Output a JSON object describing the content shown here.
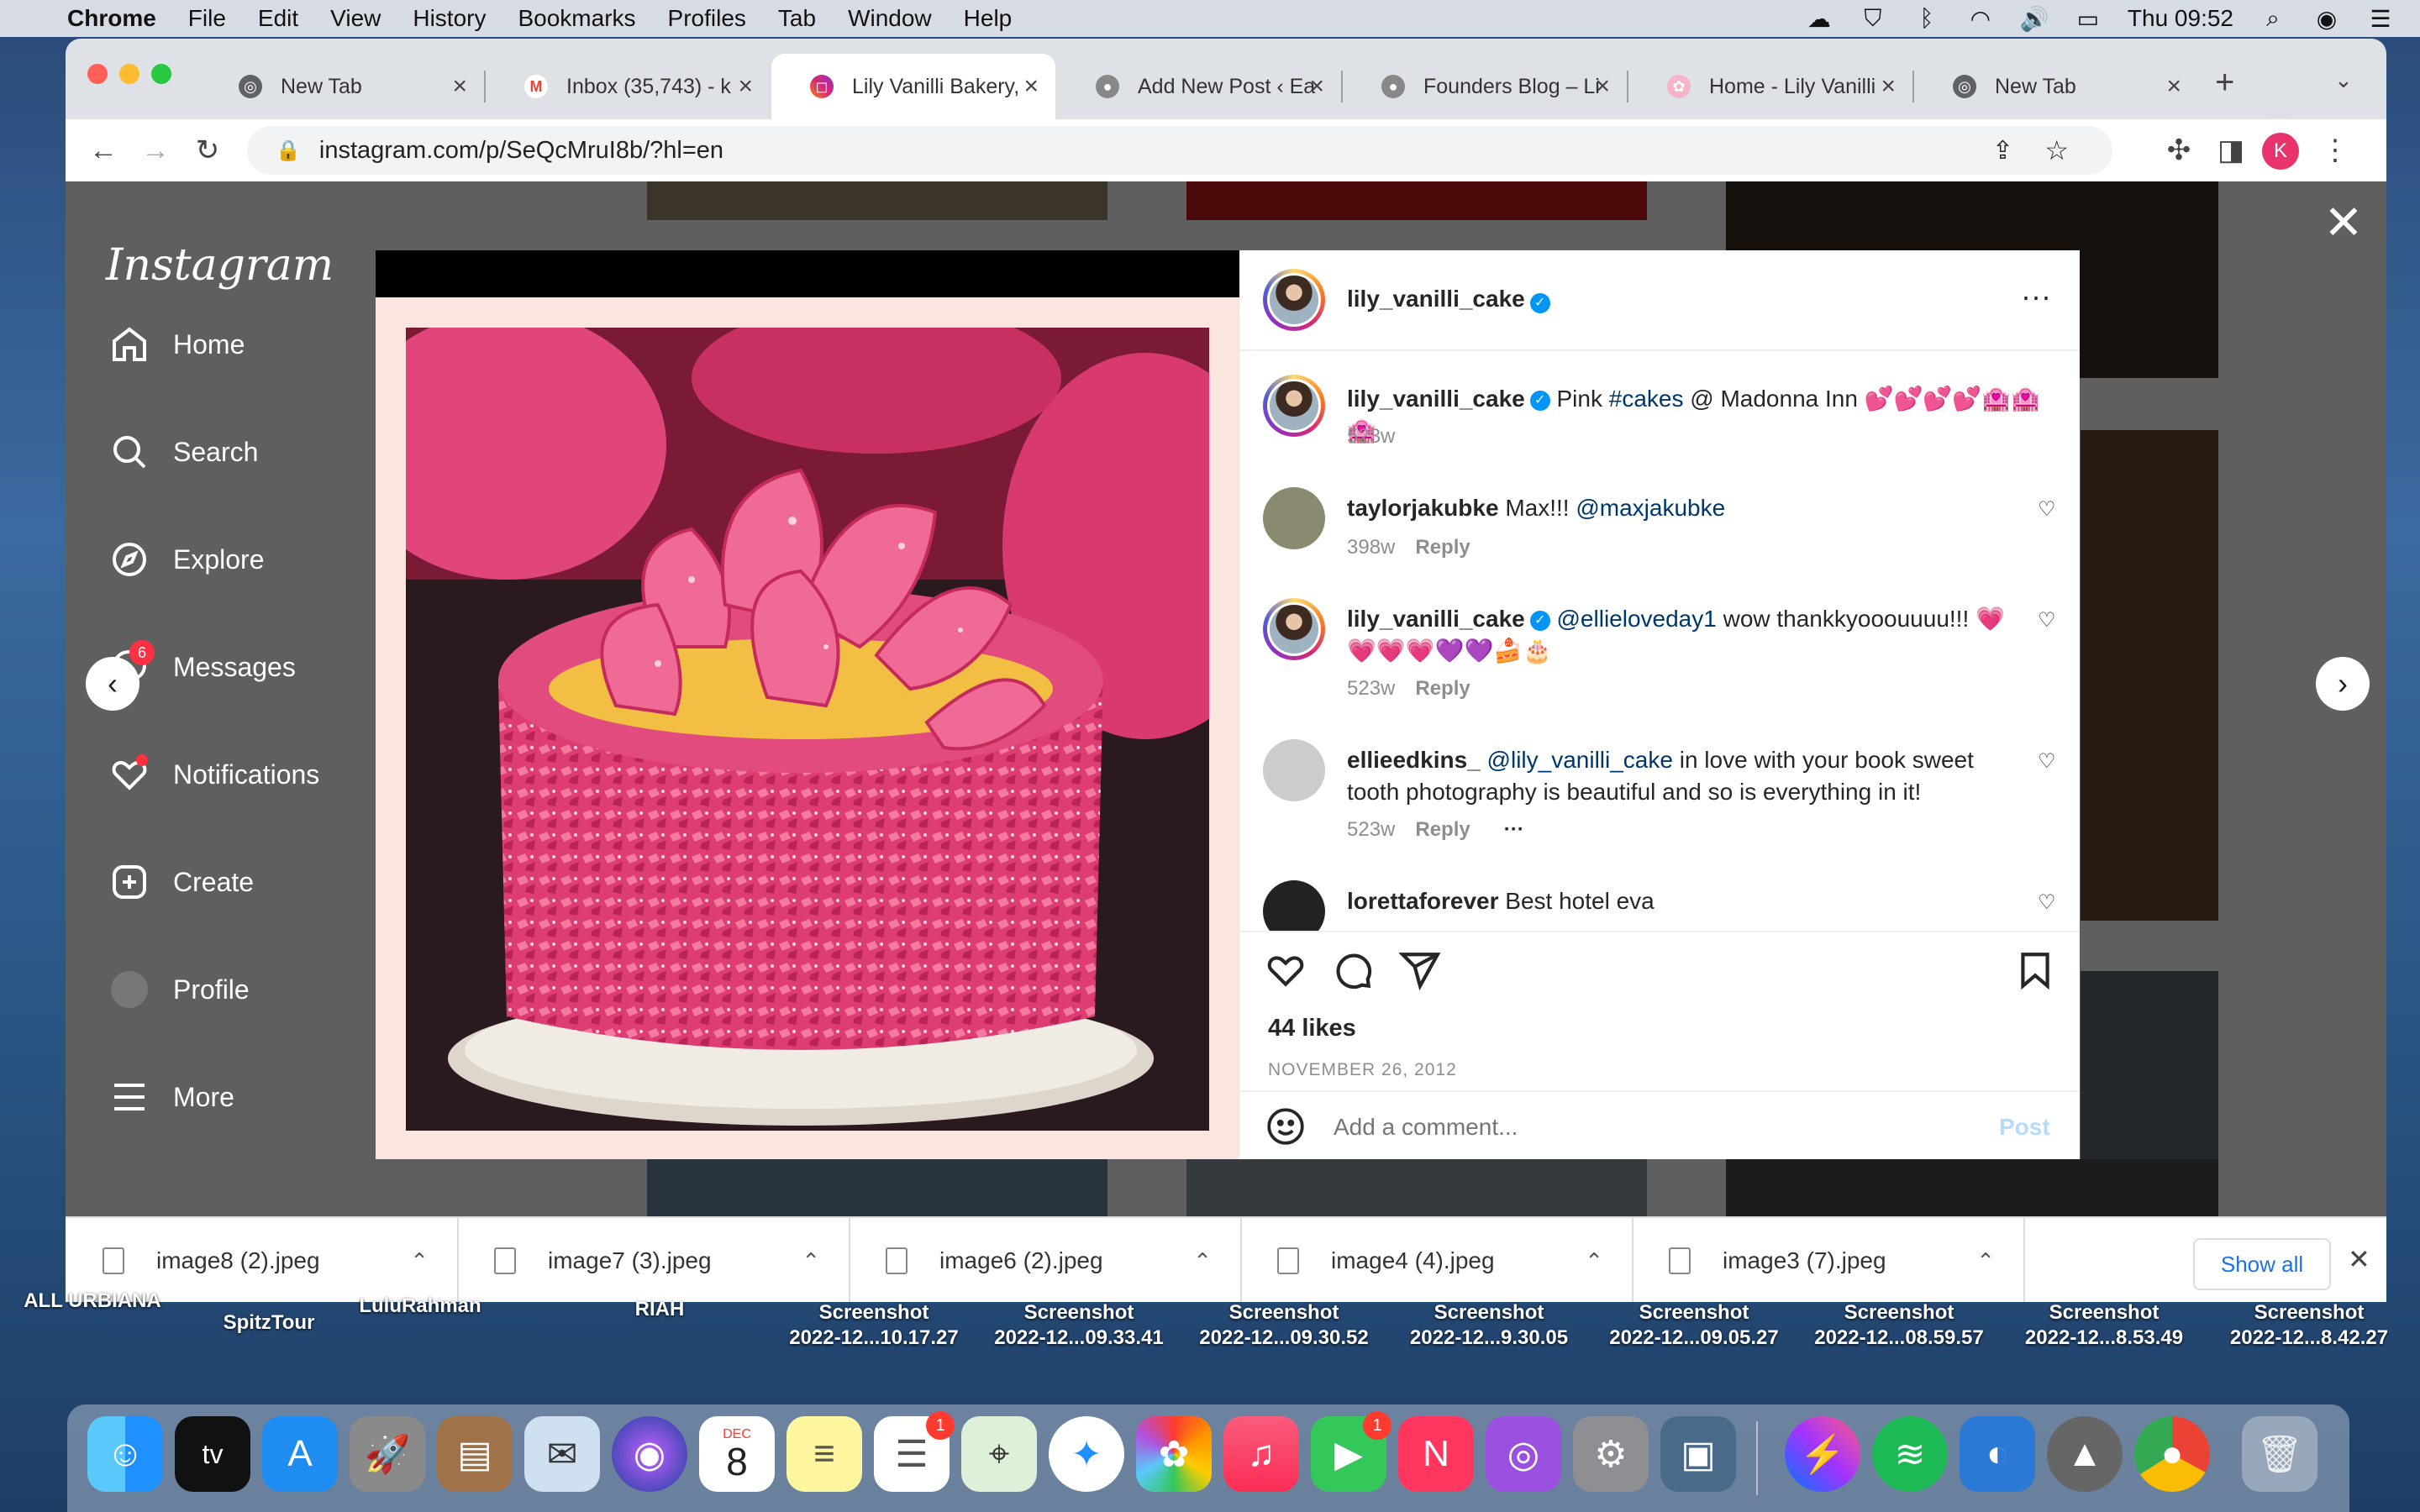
{
  "menubar": {
    "app": "Chrome",
    "items": [
      "File",
      "Edit",
      "View",
      "History",
      "Bookmarks",
      "Profiles",
      "Tab",
      "Window",
      "Help"
    ],
    "clock": "Thu 09:52"
  },
  "tabs": [
    {
      "title": "New Tab"
    },
    {
      "title": "Inbox (35,743) - k"
    },
    {
      "title": "Lily Vanilli Bakery,"
    },
    {
      "title": "Add New Post ‹ Ea"
    },
    {
      "title": "Founders Blog – Li"
    },
    {
      "title": "Home - Lily Vanilli"
    },
    {
      "title": "New Tab"
    }
  ],
  "url": "instagram.com/p/SeQcMruI8b/?hl=en",
  "profile_initial": "K",
  "instagram": {
    "logo": "Instagram",
    "nav": [
      {
        "label": "Home",
        "icon": "home-icon"
      },
      {
        "label": "Search",
        "icon": "search-icon"
      },
      {
        "label": "Explore",
        "icon": "compass-icon"
      },
      {
        "label": "Messages",
        "icon": "messenger-icon",
        "badge": "6"
      },
      {
        "label": "Notifications",
        "icon": "heart-icon"
      },
      {
        "label": "Create",
        "icon": "plus-square-icon"
      },
      {
        "label": "Profile",
        "icon": "avatar-icon"
      },
      {
        "label": "More",
        "icon": "menu-icon"
      }
    ],
    "post": {
      "author": "lily_vanilli_cake",
      "caption_prefix": "Pink ",
      "caption_tag": "#cakes",
      "caption_suffix": " @ Madonna Inn 💕💕💕💕🏩🏩🏩",
      "caption_time": "523w",
      "comments": [
        {
          "user": "taylorjakubke",
          "text": "Max!!! ",
          "mention": "@maxjakubke",
          "time": "398w",
          "reply": "Reply"
        },
        {
          "user": "lily_vanilli_cake",
          "verified": true,
          "mention": "@ellieloveday1",
          "text": " wow thankkyooouuuu!!! 💗💗💗💗💜💜🍰🎂",
          "time": "523w",
          "reply": "Reply"
        },
        {
          "user": "ellieedkins_",
          "mention": "@lily_vanilli_cake",
          "text": " in love with your book sweet tooth photography is beautiful and so is everything in it!",
          "time": "523w",
          "reply": "Reply"
        },
        {
          "user": "lorettaforever",
          "text": "Best hotel eva"
        }
      ],
      "likes": "44 likes",
      "date": "NOVEMBER 26, 2012",
      "comment_placeholder": "Add a comment...",
      "post_button": "Post"
    }
  },
  "downloads": [
    {
      "name": "image8 (2).jpeg"
    },
    {
      "name": "image7 (3).jpeg"
    },
    {
      "name": "image6 (2).jpeg"
    },
    {
      "name": "image4 (4).jpeg"
    },
    {
      "name": "image3 (7).jpeg"
    }
  ],
  "show_all": "Show all",
  "desktop_labels": [
    {
      "text": "ALL URBIANA"
    },
    {
      "text": "SpitzTour"
    },
    {
      "text": "LuluRahman"
    },
    {
      "text": "RIAH"
    },
    {
      "text": "Screenshot\n2022-12...10.17.27"
    },
    {
      "text": "Screenshot\n2022-12...09.33.41"
    },
    {
      "text": "Screenshot\n2022-12...09.30.52"
    },
    {
      "text": "Screenshot\n2022-12...9.30.05"
    },
    {
      "text": "Screenshot\n2022-12...09.05.27"
    },
    {
      "text": "Screenshot\n2022-12...08.59.57"
    },
    {
      "text": "Screenshot\n2022-12...8.53.49"
    },
    {
      "text": "Screenshot\n2022-12...8.42.27"
    }
  ],
  "dock": {
    "calendar_month": "DEC",
    "calendar_day": "8",
    "reminders_badge": "1",
    "facetime_badge": "1"
  }
}
